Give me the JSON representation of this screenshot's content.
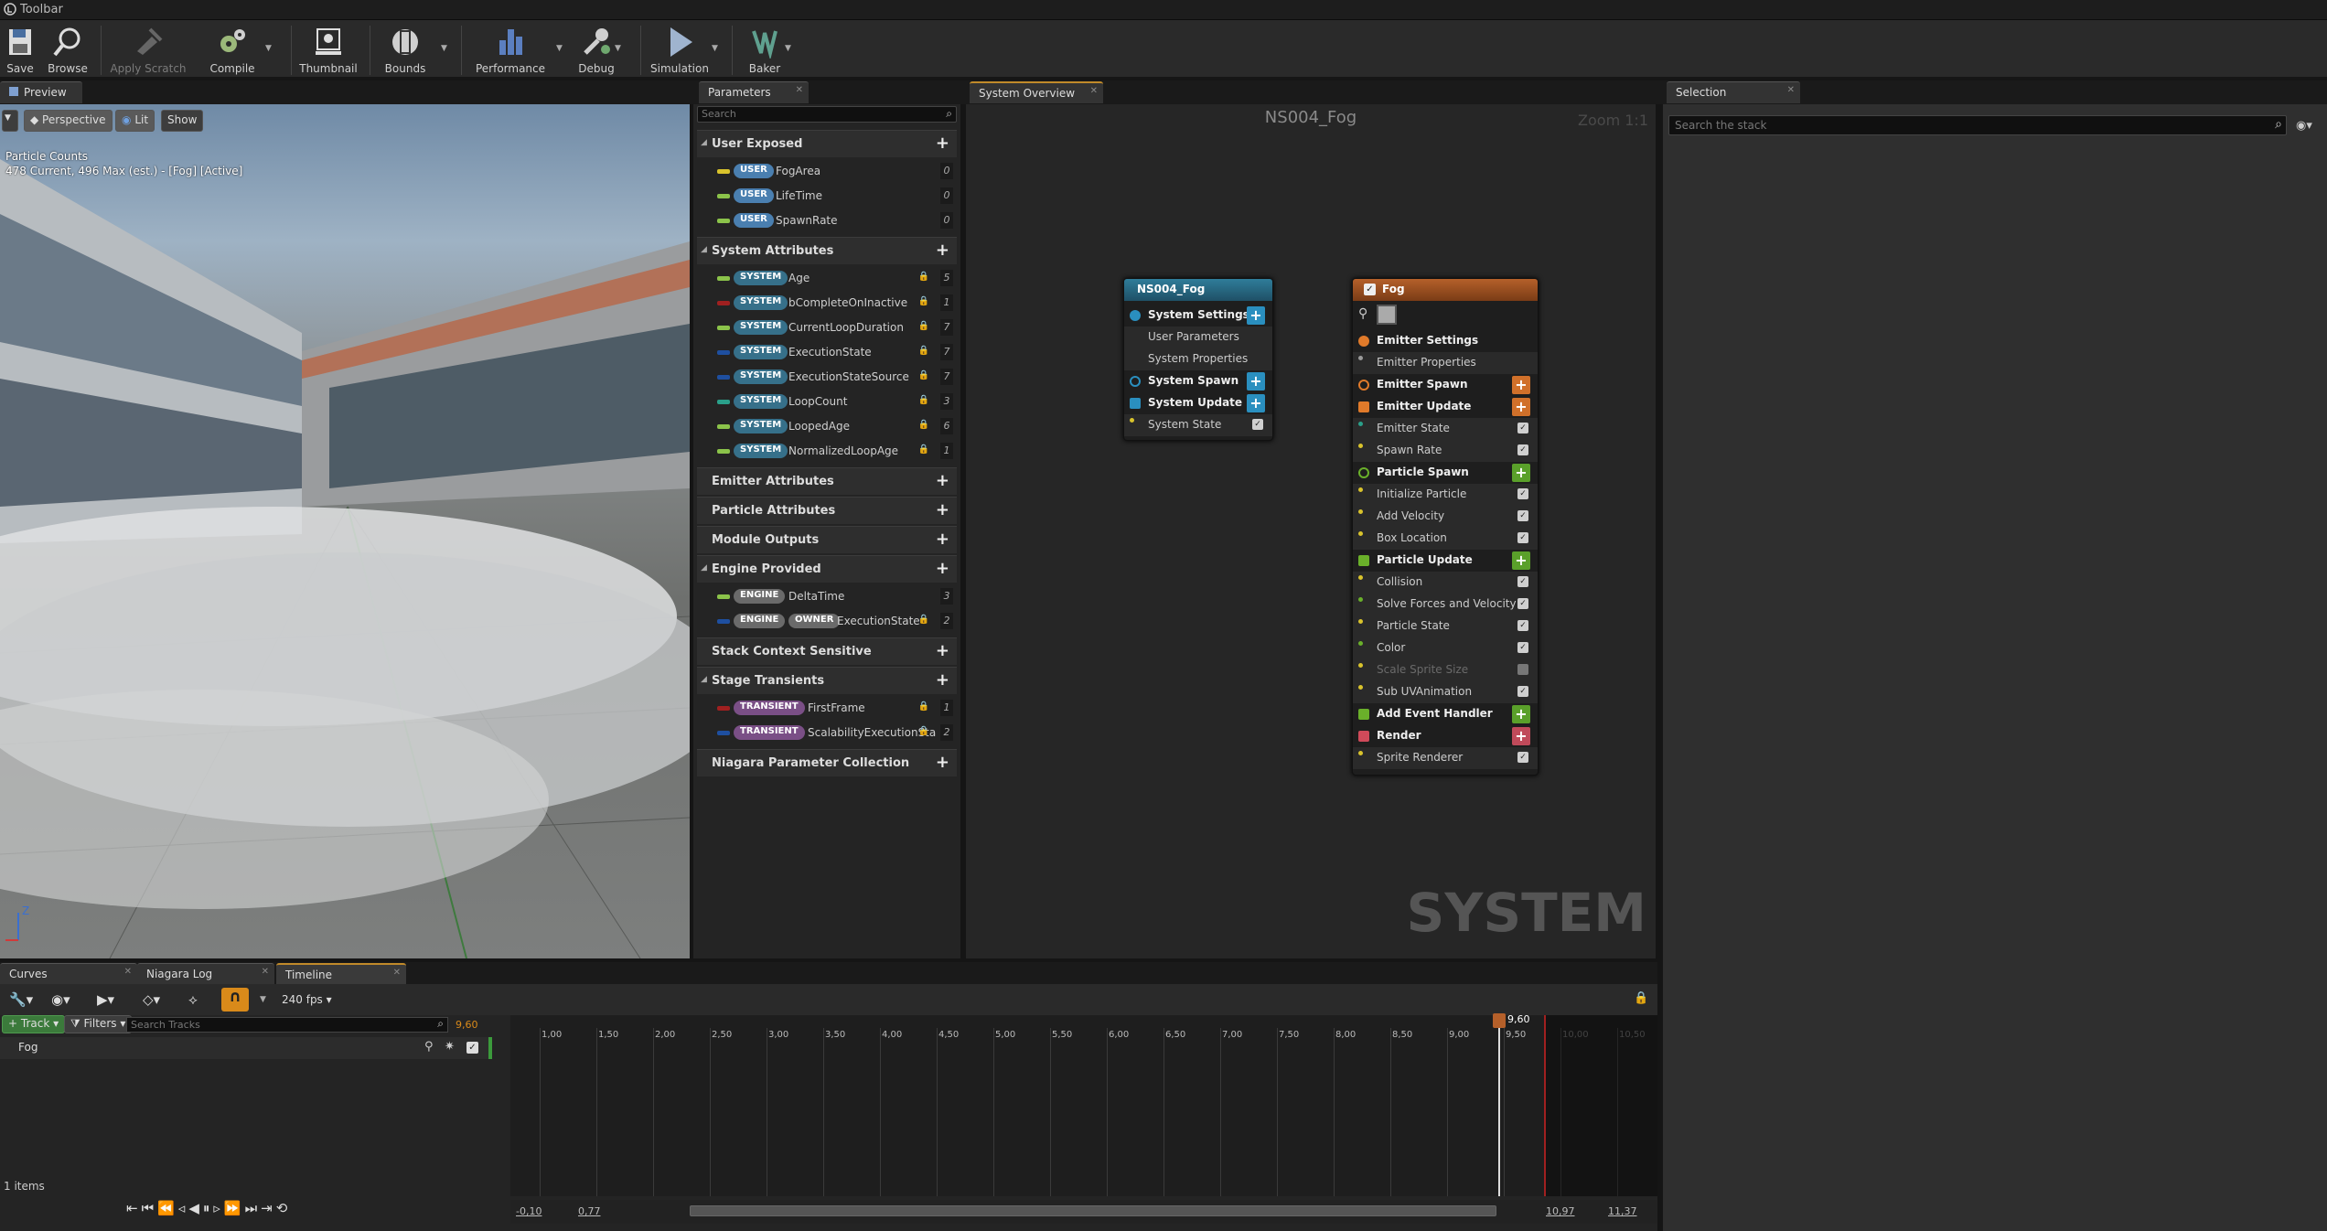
{
  "window": {
    "title": "Toolbar"
  },
  "toolbar": {
    "save": "Save",
    "browse": "Browse",
    "apply_scratch": "Apply Scratch",
    "compile": "Compile",
    "thumbnail": "Thumbnail",
    "bounds": "Bounds",
    "performance": "Performance",
    "debug": "Debug",
    "simulation": "Simulation",
    "baker": "Baker"
  },
  "preview": {
    "tab": "Preview",
    "perspective": "Perspective",
    "lit": "Lit",
    "show": "Show",
    "particle_counts_title": "Particle Counts",
    "particle_counts_value": "478 Current, 496 Max (est.) - [Fog] [Active]",
    "axis_z": "Z"
  },
  "parameters": {
    "tab": "Parameters",
    "search_placeholder": "Search",
    "sections": [
      {
        "title": "User Exposed",
        "items": [
          {
            "tag": "USER",
            "name": "FogArea",
            "count": "0",
            "color": "#d9c32c"
          },
          {
            "tag": "USER",
            "name": "LifeTime",
            "count": "0",
            "color": "#8bc34a"
          },
          {
            "tag": "USER",
            "name": "SpawnRate",
            "count": "0",
            "color": "#8bc34a"
          }
        ]
      },
      {
        "title": "System Attributes",
        "items": [
          {
            "tag": "SYSTEM",
            "name": "Age",
            "count": "5",
            "color": "#8bc34a"
          },
          {
            "tag": "SYSTEM",
            "name": "bCompleteOnInactive",
            "count": "1",
            "color": "#a02020"
          },
          {
            "tag": "SYSTEM",
            "name": "CurrentLoopDuration",
            "count": "7",
            "color": "#8bc34a"
          },
          {
            "tag": "SYSTEM",
            "name": "ExecutionState",
            "count": "7",
            "color": "#1e4fa0"
          },
          {
            "tag": "SYSTEM",
            "name": "ExecutionStateSource",
            "count": "7",
            "color": "#1e4fa0"
          },
          {
            "tag": "SYSTEM",
            "name": "LoopCount",
            "count": "3",
            "color": "#2aa08a"
          },
          {
            "tag": "SYSTEM",
            "name": "LoopedAge",
            "count": "6",
            "color": "#8bc34a"
          },
          {
            "tag": "SYSTEM",
            "name": "NormalizedLoopAge",
            "count": "1",
            "color": "#8bc34a"
          }
        ]
      },
      {
        "title": "Emitter Attributes"
      },
      {
        "title": "Particle Attributes"
      },
      {
        "title": "Module Outputs"
      },
      {
        "title": "Engine Provided",
        "items": [
          {
            "tag": "ENGINE",
            "name": "DeltaTime",
            "count": "3",
            "color": "#8bc34a"
          },
          {
            "tag": "ENGINE",
            "tag2": "OWNER",
            "name": "ExecutionState",
            "count": "2",
            "color": "#1e4fa0"
          }
        ]
      },
      {
        "title": "Stack Context Sensitive"
      },
      {
        "title": "Stage Transients",
        "items": [
          {
            "tag": "TRANSIENT",
            "name": "FirstFrame",
            "count": "1",
            "color": "#a02020"
          },
          {
            "tag": "TRANSIENT",
            "name": "ScalabilityExecutionSta",
            "count": "2",
            "color": "#1e4fa0"
          }
        ]
      },
      {
        "title": "Niagara Parameter Collection"
      }
    ]
  },
  "system_overview": {
    "tab": "System Overview",
    "title": "NS004_Fog",
    "zoom": "Zoom 1:1",
    "watermark": "SYSTEM",
    "system_node": {
      "title": "NS004_Fog",
      "rows": [
        "System Settings",
        "User Parameters",
        "System Properties",
        "System Spawn",
        "System Update",
        "System State"
      ]
    },
    "emitter_node": {
      "title": "Fog",
      "rows": [
        "Emitter Settings",
        "Emitter Properties",
        "Emitter Spawn",
        "Emitter Update",
        "Emitter State",
        "Spawn Rate",
        "Particle Spawn",
        "Initialize Particle",
        "Add Velocity",
        "Box Location",
        "Particle Update",
        "Collision",
        "Solve Forces and Velocity",
        "Particle State",
        "Color",
        "Scale Sprite Size",
        "Sub UVAnimation",
        "Add Event Handler",
        "Render",
        "Sprite Renderer"
      ]
    }
  },
  "selection": {
    "tab": "Selection",
    "search_placeholder": "Search the stack"
  },
  "bottom_tabs": [
    "Curves",
    "Niagara Log",
    "Timeline"
  ],
  "timeline": {
    "fps": "240 fps",
    "track_button": "Track",
    "filters_button": "Filters",
    "search_placeholder": "Search Tracks",
    "current_time": "9,60",
    "playhead": "9,60",
    "tracks": [
      "Fog"
    ],
    "item_count": "1 items",
    "ticks": [
      "1,00",
      "1,50",
      "2,00",
      "2,50",
      "3,00",
      "3,50",
      "4,00",
      "4,50",
      "5,00",
      "5,50",
      "6,00",
      "6,50",
      "7,00",
      "7,50",
      "8,00",
      "8,50",
      "9,00",
      "9,50",
      "10,00",
      "10,50"
    ],
    "range_start": "-0,10",
    "range_view_start": "0,77",
    "range_view_end": "10,97",
    "range_end": "11,37"
  }
}
